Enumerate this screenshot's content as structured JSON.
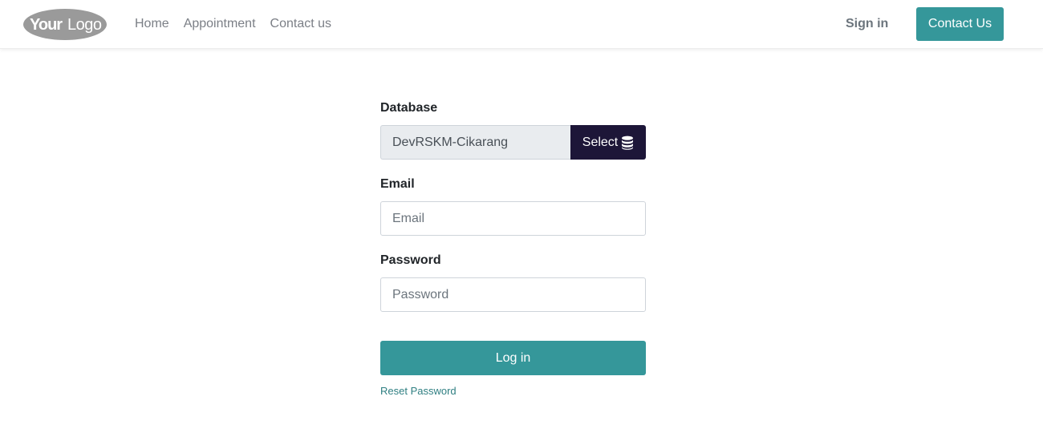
{
  "header": {
    "logo_text": "YourLogo",
    "nav": [
      "Home",
      "Appointment",
      "Contact us"
    ],
    "sign_in": "Sign in",
    "contact_button": "Contact Us"
  },
  "login_form": {
    "database_label": "Database",
    "database_value": "DevRSKM-Cikarang",
    "select_button": "Select",
    "select_icon": "database-icon",
    "email_label": "Email",
    "email_placeholder": "Email",
    "password_label": "Password",
    "password_placeholder": "Password",
    "login_button": "Log in",
    "reset_link": "Reset Password"
  },
  "colors": {
    "accent": "#35979a",
    "select_button_bg": "#1d1638",
    "nav_text": "#7b7f86"
  }
}
